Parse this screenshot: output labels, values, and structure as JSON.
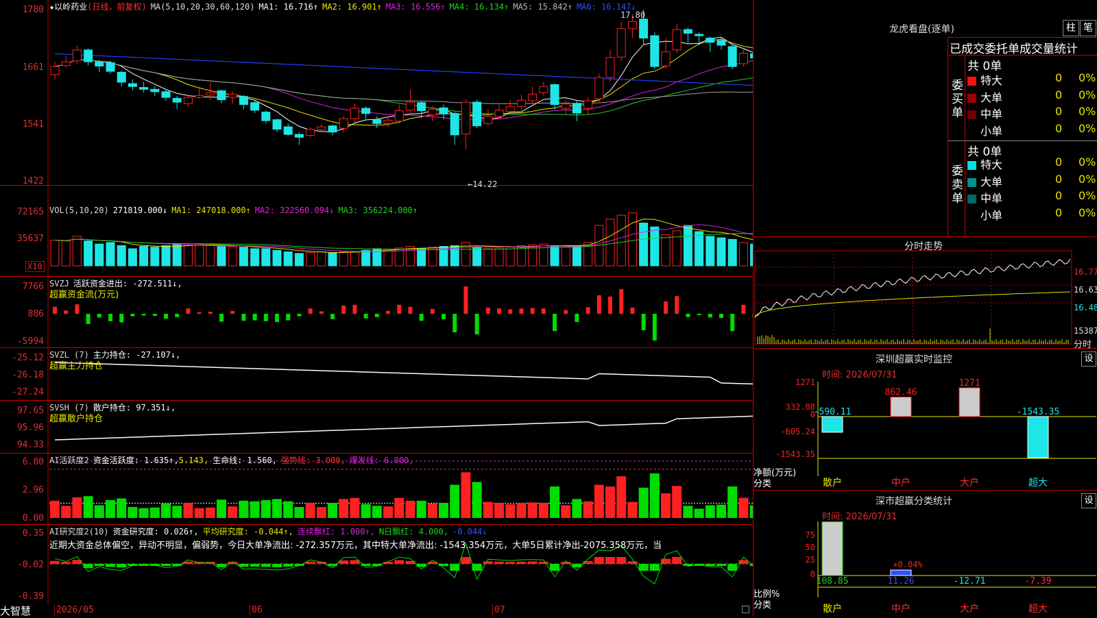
{
  "app": {
    "corner_logo": "大智慧"
  },
  "colors": {
    "up": "#ff2020",
    "down": "#1ee6e6",
    "ma1": "#ffffff",
    "ma2": "#e8e800",
    "ma3": "#e020e0",
    "ma4": "#20d020",
    "ma5": "#a0a0a0",
    "ma6": "#2040ff",
    "frame": "#c00000",
    "pos": "#ff2020",
    "neg": "#00dd00"
  },
  "kline": {
    "star": "★",
    "stock_name": "以岭药业",
    "mode": "(日线，前复权)",
    "ma_params": "MA(5,10,20,30,60,120)",
    "ma1": "MA1: 16.716↑",
    "ma2": "MA2: 16.901↑",
    "ma3": "MA3: 16.556↑",
    "ma4": "MA4: 16.134↑",
    "ma5": "MA5: 15.842↑",
    "ma6": "MA6: 16.147↓",
    "yticks": [
      "1780",
      "1661",
      "1541",
      "1422"
    ],
    "high_label": "17.80",
    "low_label": "←14.22"
  },
  "vol": {
    "title": "VOL(5,10,20)",
    "val": "271819.000↓",
    "ma1": "MA1: 247018.000↑",
    "ma2": "MA2: 322560.094↓",
    "ma3": "MA3: 356224.000↑",
    "yticks": [
      "72165",
      "35637"
    ],
    "unit": "X10"
  },
  "svzj": {
    "title": "SVZJ",
    "label": "活跃资金进出: -272.511↓,",
    "sub": "超赢资金流(万元)",
    "yticks": [
      "7766",
      "886",
      "-5994"
    ]
  },
  "svzl": {
    "title": "SVZL (7)",
    "label": "主力持仓: -27.107↓,",
    "sub": "超赢主力持仓",
    "yticks": [
      "-25.12",
      "-26.18",
      "-27.24"
    ]
  },
  "svsh": {
    "title": "SVSH (7)",
    "label": "散户持仓: 97.351↓,",
    "sub": "超赢散户持仓",
    "yticks": [
      "97.65",
      "95.96",
      "94.33"
    ]
  },
  "ai1": {
    "title": "AI活跃度2",
    "p1": "资金活跃度: 1.635↑,",
    "p2": "5.143,",
    "p3": "生命线: 1.560,",
    "p4": "强势线: 3.000,",
    "p5": "爆发线: 6.000,",
    "yticks": [
      "6.00",
      "2.96",
      "0.00"
    ]
  },
  "ai2": {
    "title": "AI研究度2(10)",
    "p1": "资金研究度: 0.026↑,",
    "p2": "平均研究度: -0.044↑,",
    "p3": "连续飘红: 1.000↑,",
    "p4": "N日飘红: 4.000,",
    "p5": "-0.044↓",
    "comment": "近期大资金总体偏空，异动不明显，偏弱势，今日大单净流出: -272.357万元，其中特大单净流出: -1543.354万元，大单5日累计净出-2075.358万元，当",
    "yticks": [
      "0.35",
      "-0.02",
      "-0.39"
    ]
  },
  "xaxis": {
    "labels": [
      "2026/05",
      "06",
      "07"
    ]
  },
  "right": {
    "lhb_title": "龙虎看盘(逐单)",
    "btn_bar": "柱",
    "btn_stroke": "笔",
    "table_header": "已成交委托单成交量统计",
    "buy_label": "委买单",
    "sell_label": "委卖单",
    "buy_total": "共 0单",
    "sell_total": "共 0单",
    "buy_rows": [
      {
        "name": "特大",
        "v": "0",
        "p": "0%",
        "c": "#ff1010"
      },
      {
        "name": "大单",
        "v": "0",
        "p": "0%",
        "c": "#a00000"
      },
      {
        "name": "中单",
        "v": "0",
        "p": "0%",
        "c": "#700000"
      },
      {
        "name": "小单",
        "v": "0",
        "p": "0%",
        "c": ""
      }
    ],
    "sell_rows": [
      {
        "name": "特大",
        "v": "0",
        "p": "0%",
        "c": "#00e0e0"
      },
      {
        "name": "大单",
        "v": "0",
        "p": "0%",
        "c": "#009090"
      },
      {
        "name": "中单",
        "v": "0",
        "p": "0%",
        "c": "#006868"
      },
      {
        "name": "小单",
        "v": "0",
        "p": "0%",
        "c": ""
      }
    ],
    "fs_title": "分时走势",
    "fs_yticks": [
      "16.77",
      "16.63",
      "16.48"
    ],
    "fs_vol": "15387",
    "fs_unit": "分时",
    "mon_title": "深圳超赢实时监控",
    "set": "设",
    "mon_time": "时间: 2026/07/31",
    "mon_yticks": [
      "1271",
      "332.88",
      "0",
      "-605.24",
      "-1543.35"
    ],
    "mon_ylabel": "净额(万元)",
    "mon_xtitle": "分类",
    "mon_cats": [
      "散户",
      "中户",
      "大户",
      "超大"
    ],
    "mon_vals": [
      "-590.11",
      "862.46",
      "1271",
      "-1543.35"
    ],
    "cls_title": "深市超赢分类统计",
    "cls_time": "时间: 2026/07/31",
    "cls_yticks": [
      "75",
      "50",
      "25",
      "0"
    ],
    "cls_ylabel": "比例%",
    "cls_xtitle": "分类",
    "cls_vals": [
      "108.85",
      "11.26",
      "-12.71",
      "-7.39"
    ],
    "cls_top": "+0.04%"
  },
  "chart_data": {
    "type": "candlestick",
    "candles": [
      [
        16.43,
        16.6,
        16.7,
        16.32
      ],
      [
        16.62,
        16.7,
        16.83,
        16.58
      ],
      [
        16.72,
        16.95,
        17.05,
        16.65
      ],
      [
        16.95,
        16.7,
        16.98,
        16.62
      ],
      [
        16.7,
        16.61,
        16.74,
        16.48
      ],
      [
        16.68,
        16.5,
        16.72,
        16.45
      ],
      [
        16.48,
        16.27,
        16.52,
        16.18
      ],
      [
        16.24,
        16.18,
        16.33,
        16.1
      ],
      [
        16.16,
        16.12,
        16.28,
        16.05
      ],
      [
        16.12,
        16.07,
        16.19,
        15.98
      ],
      [
        16.07,
        15.95,
        16.12,
        15.88
      ],
      [
        15.93,
        15.85,
        15.98,
        15.7
      ],
      [
        15.82,
        15.95,
        16.0,
        15.75
      ],
      [
        15.95,
        15.99,
        16.18,
        15.92
      ],
      [
        16.0,
        16.05,
        16.28,
        15.9
      ],
      [
        16.09,
        15.9,
        16.12,
        15.82
      ],
      [
        15.95,
        16.02,
        16.08,
        15.82
      ],
      [
        15.97,
        15.8,
        16.0,
        15.7
      ],
      [
        15.84,
        15.68,
        15.88,
        15.62
      ],
      [
        15.64,
        15.46,
        15.68,
        15.4
      ],
      [
        15.48,
        15.28,
        15.5,
        15.22
      ],
      [
        15.33,
        15.17,
        15.4,
        15.14
      ],
      [
        15.17,
        15.11,
        15.22,
        14.95
      ],
      [
        15.15,
        15.28,
        15.32,
        15.1
      ],
      [
        15.27,
        15.33,
        15.4,
        15.2
      ],
      [
        15.35,
        15.22,
        15.38,
        15.15
      ],
      [
        15.3,
        15.5,
        15.56,
        15.2
      ],
      [
        15.5,
        15.72,
        15.82,
        15.41
      ],
      [
        15.72,
        15.61,
        15.76,
        15.5
      ],
      [
        15.48,
        15.4,
        15.55,
        15.3
      ],
      [
        15.4,
        15.47,
        15.55,
        15.32
      ],
      [
        15.45,
        15.67,
        15.8,
        15.4
      ],
      [
        15.68,
        15.85,
        16.12,
        15.6
      ],
      [
        15.84,
        15.67,
        15.88,
        15.52
      ],
      [
        15.58,
        15.7,
        15.77,
        15.45
      ],
      [
        15.73,
        15.6,
        15.8,
        15.48
      ],
      [
        15.61,
        15.16,
        15.65,
        14.95
      ],
      [
        15.18,
        15.85,
        15.92,
        14.86
      ],
      [
        15.85,
        15.35,
        15.9,
        15.3
      ],
      [
        15.4,
        15.55,
        15.7,
        15.35
      ],
      [
        15.55,
        15.68,
        15.8,
        15.5
      ],
      [
        15.65,
        15.76,
        15.9,
        15.62
      ],
      [
        15.76,
        15.89,
        16.0,
        15.68
      ],
      [
        15.88,
        16.02,
        16.18,
        15.8
      ],
      [
        16.05,
        16.18,
        16.28,
        15.98
      ],
      [
        16.22,
        15.8,
        16.24,
        15.7
      ],
      [
        15.72,
        15.81,
        15.9,
        15.6
      ],
      [
        15.82,
        15.62,
        15.88,
        15.45
      ],
      [
        15.72,
        15.88,
        15.95,
        15.58
      ],
      [
        15.92,
        16.37,
        16.45,
        15.85
      ],
      [
        16.37,
        16.79,
        16.95,
        16.28
      ],
      [
        16.8,
        17.4,
        17.55,
        16.72
      ],
      [
        17.4,
        17.55,
        17.7,
        17.2
      ],
      [
        17.6,
        17.2,
        17.8,
        17.05
      ],
      [
        17.25,
        16.6,
        17.32,
        16.55
      ],
      [
        16.61,
        16.91,
        17.2,
        16.55
      ],
      [
        16.95,
        17.38,
        17.5,
        16.88
      ],
      [
        17.38,
        17.3,
        17.42,
        17.1
      ],
      [
        17.28,
        17.25,
        17.32,
        17.05
      ],
      [
        17.2,
        17.11,
        17.24,
        16.9
      ],
      [
        17.15,
        17.05,
        17.22,
        16.96
      ],
      [
        17.02,
        16.6,
        17.08,
        16.55
      ],
      [
        16.66,
        16.88,
        16.96,
        16.6
      ],
      [
        16.87,
        16.78,
        17.1,
        16.7
      ],
      [
        16.75,
        16.76,
        16.85,
        16.66
      ],
      [
        16.85,
        16.72,
        17.1,
        16.6
      ],
      [
        16.78,
        16.52,
        16.84,
        16.42
      ]
    ],
    "volume_x10": [
      33000,
      32000,
      38000,
      32000,
      28000,
      30000,
      26000,
      22000,
      25000,
      24000,
      26000,
      28000,
      27000,
      28000,
      26000,
      25000,
      25000,
      24000,
      22000,
      22000,
      20000,
      18000,
      16000,
      17000,
      18000,
      17000,
      18000,
      18000,
      20000,
      22000,
      21000,
      23000,
      25000,
      22000,
      24000,
      25000,
      26000,
      30000,
      24000,
      22000,
      23000,
      24000,
      26000,
      27000,
      28000,
      25000,
      24000,
      26000,
      30000,
      52000,
      60000,
      65000,
      68000,
      55000,
      50000,
      40000,
      45000,
      52000,
      44000,
      38000,
      36000,
      34000,
      30000,
      28000,
      26000,
      32000,
      29000
    ]
  }
}
